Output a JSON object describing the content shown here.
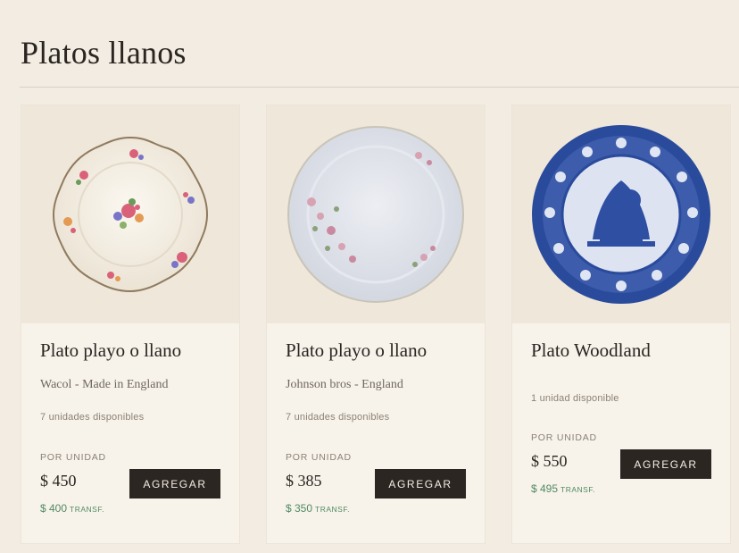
{
  "page": {
    "title": "Platos llanos"
  },
  "products": [
    {
      "title": "Plato playo o llano",
      "subtitle": "Wacol - Made in England",
      "stock": "7 unidades disponibles",
      "unit_label": "POR UNIDAD",
      "price": "$ 450",
      "transfer_price": "$ 400",
      "transfer_label": "TRANSF.",
      "button_label": "AGREGAR",
      "image_icon": "floral-plate-icon",
      "plate_color": "#f3eee4"
    },
    {
      "title": "Plato playo o llano",
      "subtitle": "Johnson bros - England",
      "stock": "7 unidades disponibles",
      "unit_label": "POR UNIDAD",
      "price": "$ 385",
      "transfer_price": "$ 350",
      "transfer_label": "TRANSF.",
      "button_label": "AGREGAR",
      "image_icon": "rose-plate-icon",
      "plate_color": "#dfe2ea"
    },
    {
      "title": "Plato Woodland",
      "stock": "1 unidad disponible",
      "unit_label": "POR UNIDAD",
      "price": "$ 550",
      "transfer_price": "$ 495",
      "transfer_label": "TRANSF.",
      "button_label": "AGREGAR",
      "image_icon": "blue-transferware-plate-icon",
      "plate_color": "#2a4a9c"
    }
  ],
  "colors": {
    "background": "#f2ece2",
    "card": "#f8f3ea",
    "button": "#2c2623",
    "transfer_green": "#4f8a63"
  }
}
